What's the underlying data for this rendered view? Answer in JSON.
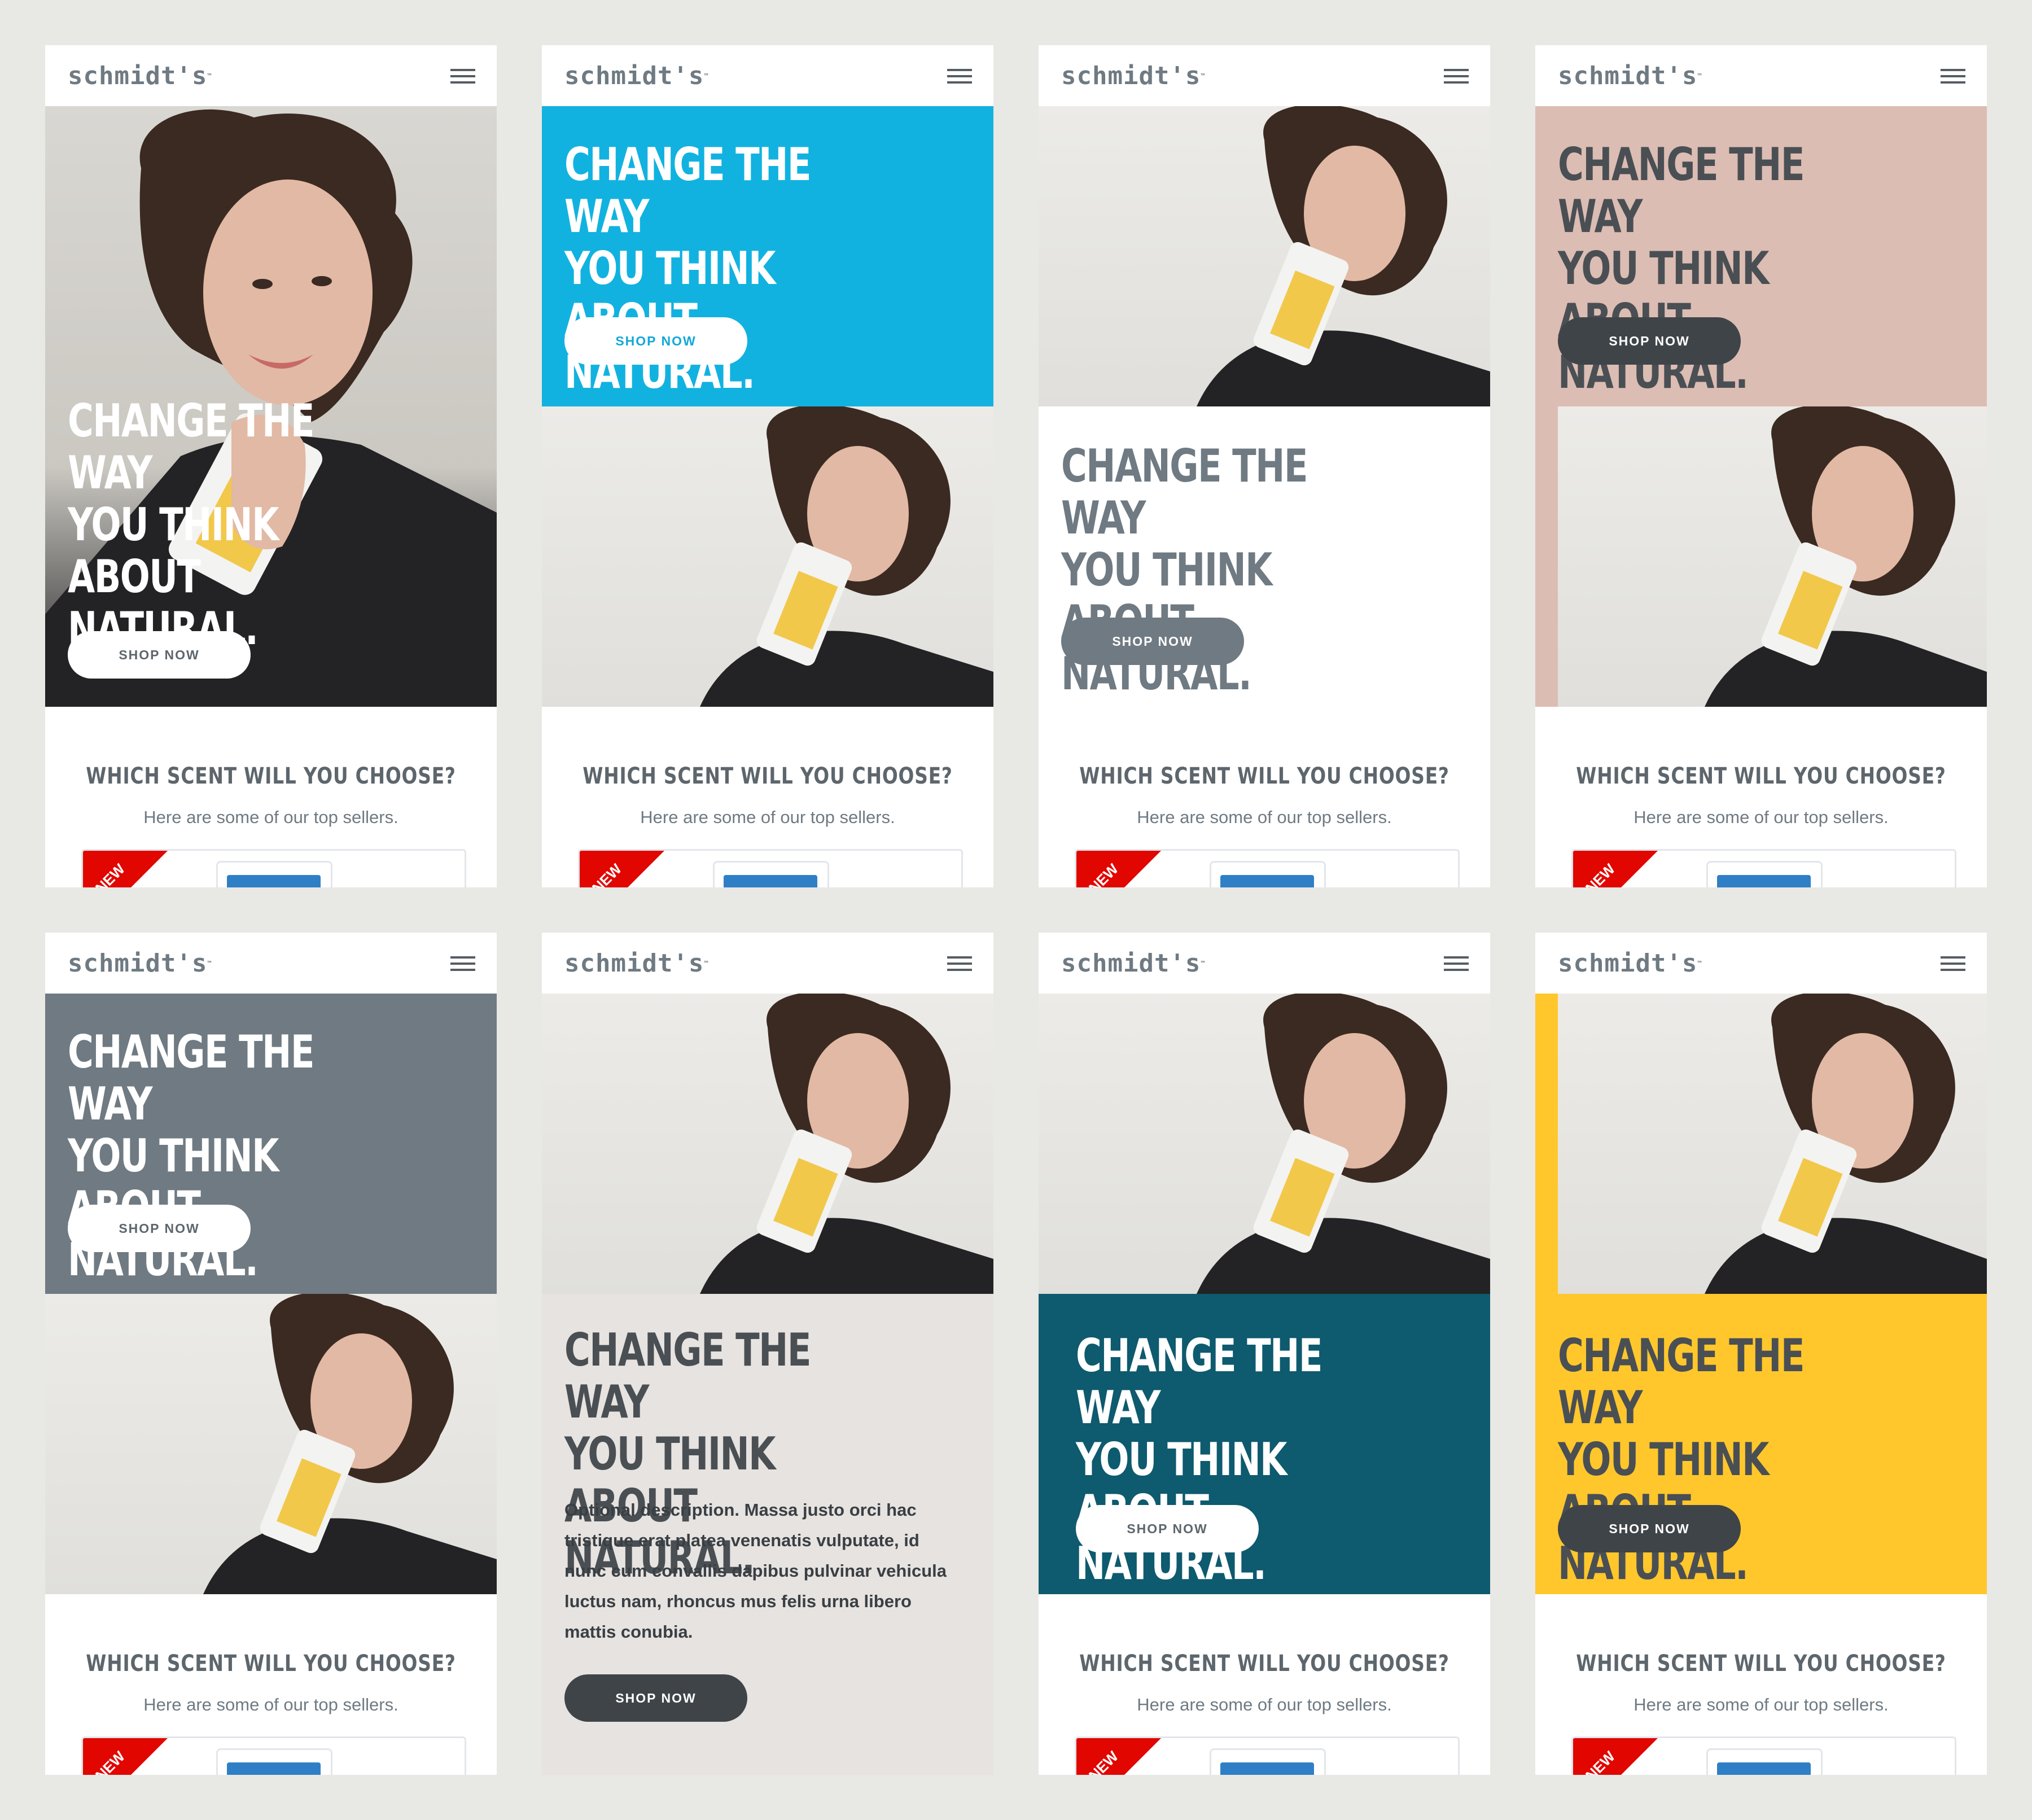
{
  "brand": {
    "logo_text": "schmidt's",
    "trademark": "™"
  },
  "hero": {
    "headline_lines": [
      "CHANGE THE WAY",
      "YOU THINK ABOUT",
      "NATURAL."
    ],
    "cta_label": "SHOP NOW",
    "optional_description": "Optional description. Massa justo orci hac tristique erat platea venenatis vulputate, id nunc cum convallis dapibus pulvinar vehicula luctus nam, rhoncus mus felis urna libero mattis conubia."
  },
  "section": {
    "title": "WHICH SCENT WILL YOU CHOOSE?",
    "subtitle": "Here are some of our top sellers.",
    "badge_text": "NEW"
  },
  "icons": {
    "menu": "hamburger-menu-icon"
  },
  "colors": {
    "brand_grey": "#6f7a82",
    "blue": "#12b2e0",
    "blush": "#dcbdb3",
    "slate": "#6f7a82",
    "stone": "#e6e3e0",
    "teal": "#0e5a6e",
    "yellow": "#ffc72c",
    "dark_button": "#3f4448",
    "badge_red": "#e10600"
  }
}
